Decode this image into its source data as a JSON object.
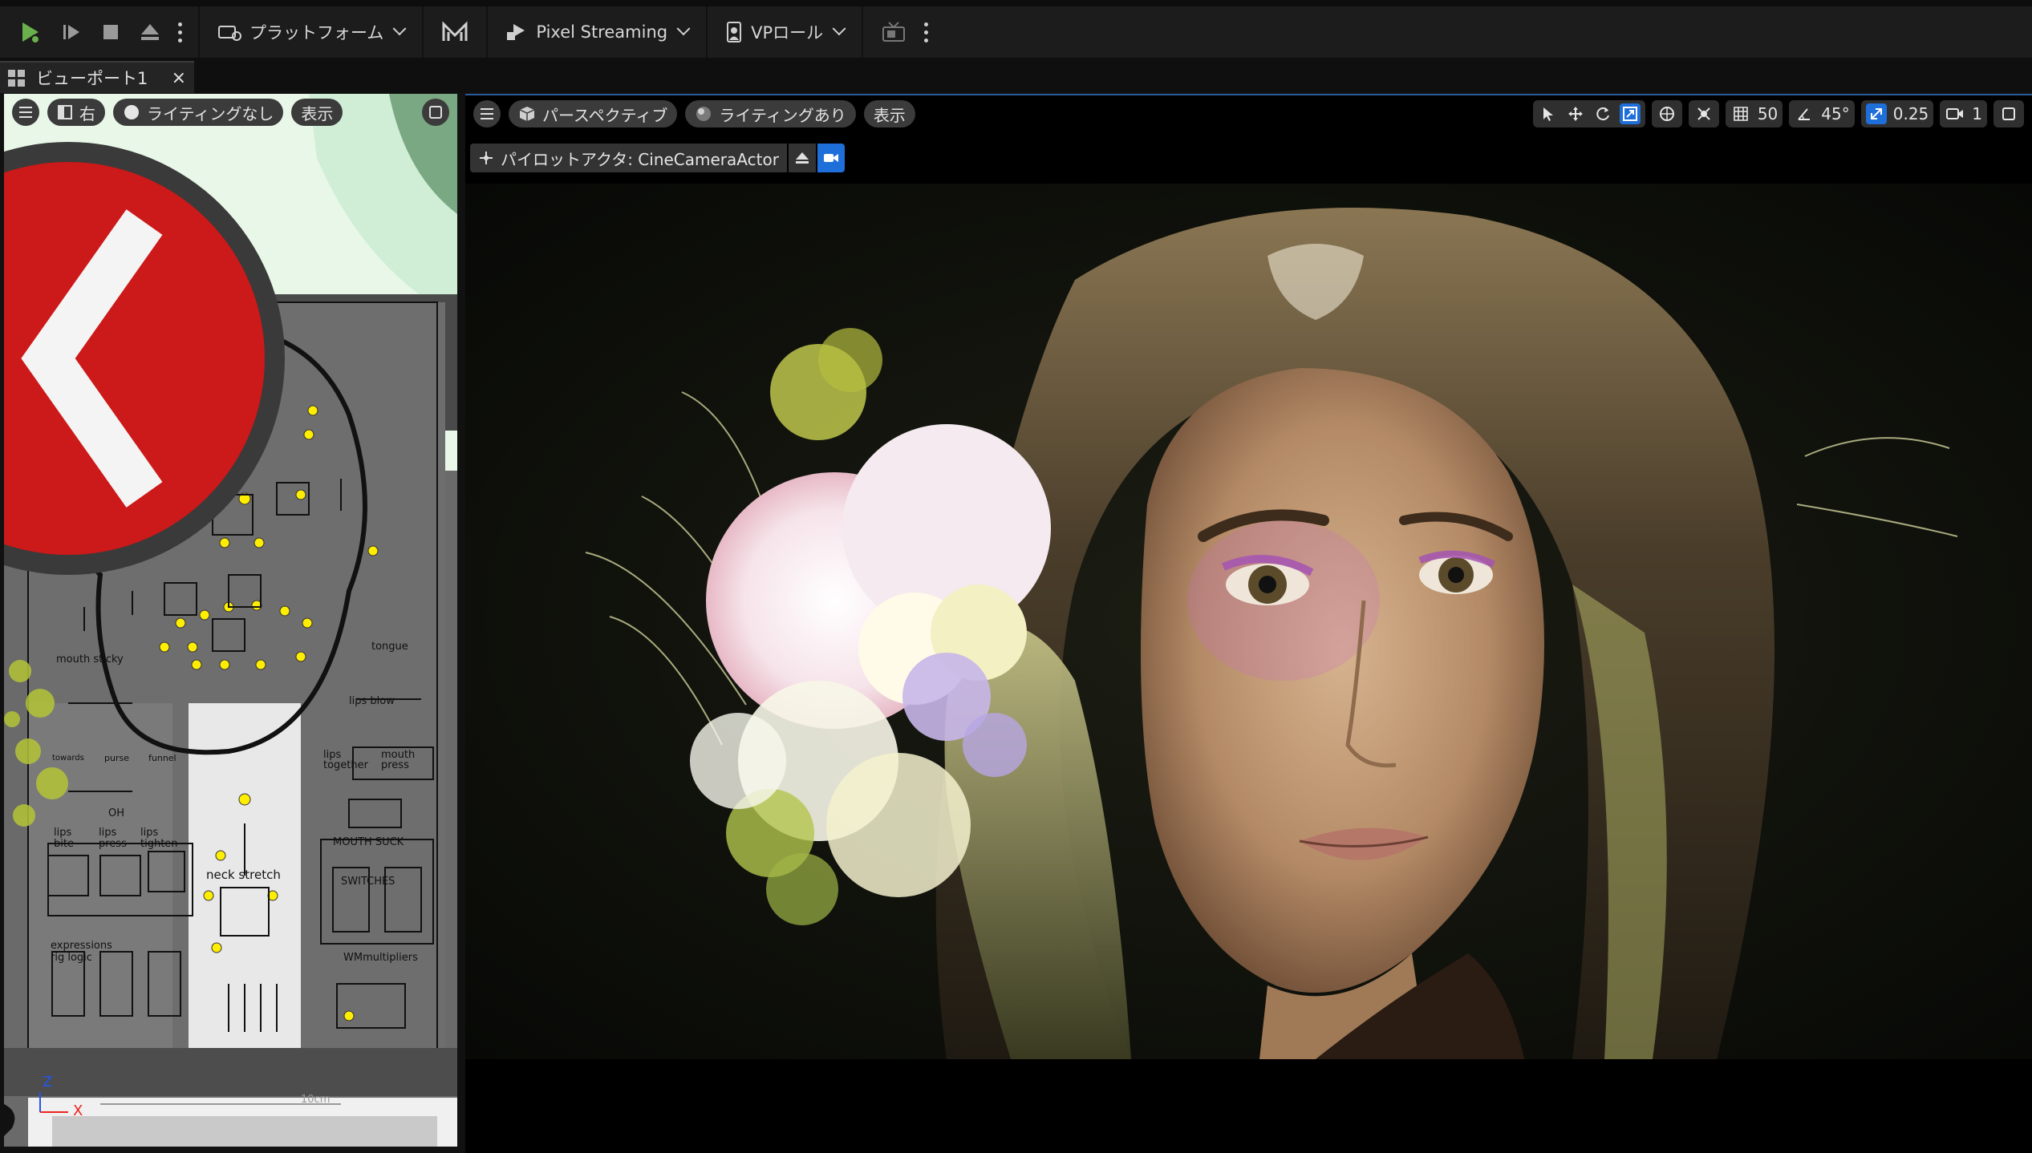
{
  "toolbar": {
    "platform_label": "プラットフォーム",
    "pixel_streaming_label": "Pixel Streaming",
    "vp_role_label": "VPロール"
  },
  "tab": {
    "label": "ビューポート1",
    "close": "×"
  },
  "left_viewport": {
    "view_label": "右",
    "lighting_label": "ライティングなし",
    "show_label": "表示",
    "rig": {
      "mouth_sticky": "mouth sticky",
      "tongue": "tongue",
      "lips_blow": "lips blow",
      "towards": "towards",
      "purse": "purse",
      "funnel": "funnel",
      "oh": "OH",
      "lips_together": "lips together",
      "mouth_press": "mouth press",
      "mouth_suck": "MOUTH SUCK",
      "lips_bite": "lips bite",
      "lips_press": "lips press",
      "lips_tighten": "lips tighten",
      "neck_stretch": "neck stretch",
      "switches": "SWITCHES",
      "expressions": "expressions",
      "rig_logic": "rig logic",
      "wm_multipliers": "WMmultipliers"
    },
    "scale_label": "10cm",
    "axis_z": "Z",
    "axis_x": "X"
  },
  "main_viewport": {
    "perspective_label": "パースペクティブ",
    "lighting_label": "ライティングあり",
    "show_label": "表示",
    "grid_value": "50",
    "angle_value": "45°",
    "scale_value": "0.25",
    "camera_speed": "1",
    "pilot_label": "パイロットアクタ: CineCameraActor"
  },
  "colors": {
    "accent": "#1e6fd9",
    "toolbar_bg": "#1c1c1c",
    "play_green": "#6ab04c",
    "rig_yellow": "#ffee00"
  }
}
